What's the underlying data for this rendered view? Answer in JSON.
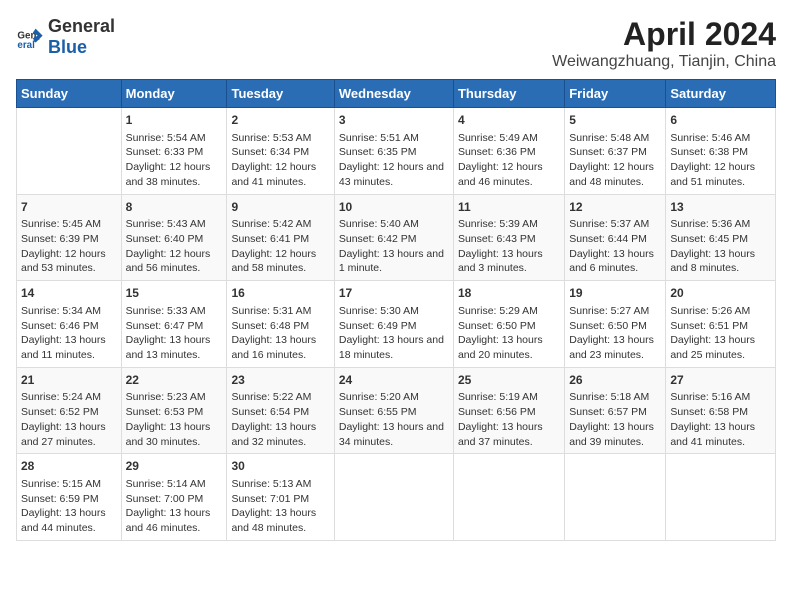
{
  "header": {
    "logo_general": "General",
    "logo_blue": "Blue",
    "title": "April 2024",
    "subtitle": "Weiwangzhuang, Tianjin, China"
  },
  "calendar": {
    "days_of_week": [
      "Sunday",
      "Monday",
      "Tuesday",
      "Wednesday",
      "Thursday",
      "Friday",
      "Saturday"
    ],
    "weeks": [
      [
        {
          "day": "",
          "sunrise": "",
          "sunset": "",
          "daylight": ""
        },
        {
          "day": "1",
          "sunrise": "Sunrise: 5:54 AM",
          "sunset": "Sunset: 6:33 PM",
          "daylight": "Daylight: 12 hours and 38 minutes."
        },
        {
          "day": "2",
          "sunrise": "Sunrise: 5:53 AM",
          "sunset": "Sunset: 6:34 PM",
          "daylight": "Daylight: 12 hours and 41 minutes."
        },
        {
          "day": "3",
          "sunrise": "Sunrise: 5:51 AM",
          "sunset": "Sunset: 6:35 PM",
          "daylight": "Daylight: 12 hours and 43 minutes."
        },
        {
          "day": "4",
          "sunrise": "Sunrise: 5:49 AM",
          "sunset": "Sunset: 6:36 PM",
          "daylight": "Daylight: 12 hours and 46 minutes."
        },
        {
          "day": "5",
          "sunrise": "Sunrise: 5:48 AM",
          "sunset": "Sunset: 6:37 PM",
          "daylight": "Daylight: 12 hours and 48 minutes."
        },
        {
          "day": "6",
          "sunrise": "Sunrise: 5:46 AM",
          "sunset": "Sunset: 6:38 PM",
          "daylight": "Daylight: 12 hours and 51 minutes."
        }
      ],
      [
        {
          "day": "7",
          "sunrise": "Sunrise: 5:45 AM",
          "sunset": "Sunset: 6:39 PM",
          "daylight": "Daylight: 12 hours and 53 minutes."
        },
        {
          "day": "8",
          "sunrise": "Sunrise: 5:43 AM",
          "sunset": "Sunset: 6:40 PM",
          "daylight": "Daylight: 12 hours and 56 minutes."
        },
        {
          "day": "9",
          "sunrise": "Sunrise: 5:42 AM",
          "sunset": "Sunset: 6:41 PM",
          "daylight": "Daylight: 12 hours and 58 minutes."
        },
        {
          "day": "10",
          "sunrise": "Sunrise: 5:40 AM",
          "sunset": "Sunset: 6:42 PM",
          "daylight": "Daylight: 13 hours and 1 minute."
        },
        {
          "day": "11",
          "sunrise": "Sunrise: 5:39 AM",
          "sunset": "Sunset: 6:43 PM",
          "daylight": "Daylight: 13 hours and 3 minutes."
        },
        {
          "day": "12",
          "sunrise": "Sunrise: 5:37 AM",
          "sunset": "Sunset: 6:44 PM",
          "daylight": "Daylight: 13 hours and 6 minutes."
        },
        {
          "day": "13",
          "sunrise": "Sunrise: 5:36 AM",
          "sunset": "Sunset: 6:45 PM",
          "daylight": "Daylight: 13 hours and 8 minutes."
        }
      ],
      [
        {
          "day": "14",
          "sunrise": "Sunrise: 5:34 AM",
          "sunset": "Sunset: 6:46 PM",
          "daylight": "Daylight: 13 hours and 11 minutes."
        },
        {
          "day": "15",
          "sunrise": "Sunrise: 5:33 AM",
          "sunset": "Sunset: 6:47 PM",
          "daylight": "Daylight: 13 hours and 13 minutes."
        },
        {
          "day": "16",
          "sunrise": "Sunrise: 5:31 AM",
          "sunset": "Sunset: 6:48 PM",
          "daylight": "Daylight: 13 hours and 16 minutes."
        },
        {
          "day": "17",
          "sunrise": "Sunrise: 5:30 AM",
          "sunset": "Sunset: 6:49 PM",
          "daylight": "Daylight: 13 hours and 18 minutes."
        },
        {
          "day": "18",
          "sunrise": "Sunrise: 5:29 AM",
          "sunset": "Sunset: 6:50 PM",
          "daylight": "Daylight: 13 hours and 20 minutes."
        },
        {
          "day": "19",
          "sunrise": "Sunrise: 5:27 AM",
          "sunset": "Sunset: 6:50 PM",
          "daylight": "Daylight: 13 hours and 23 minutes."
        },
        {
          "day": "20",
          "sunrise": "Sunrise: 5:26 AM",
          "sunset": "Sunset: 6:51 PM",
          "daylight": "Daylight: 13 hours and 25 minutes."
        }
      ],
      [
        {
          "day": "21",
          "sunrise": "Sunrise: 5:24 AM",
          "sunset": "Sunset: 6:52 PM",
          "daylight": "Daylight: 13 hours and 27 minutes."
        },
        {
          "day": "22",
          "sunrise": "Sunrise: 5:23 AM",
          "sunset": "Sunset: 6:53 PM",
          "daylight": "Daylight: 13 hours and 30 minutes."
        },
        {
          "day": "23",
          "sunrise": "Sunrise: 5:22 AM",
          "sunset": "Sunset: 6:54 PM",
          "daylight": "Daylight: 13 hours and 32 minutes."
        },
        {
          "day": "24",
          "sunrise": "Sunrise: 5:20 AM",
          "sunset": "Sunset: 6:55 PM",
          "daylight": "Daylight: 13 hours and 34 minutes."
        },
        {
          "day": "25",
          "sunrise": "Sunrise: 5:19 AM",
          "sunset": "Sunset: 6:56 PM",
          "daylight": "Daylight: 13 hours and 37 minutes."
        },
        {
          "day": "26",
          "sunrise": "Sunrise: 5:18 AM",
          "sunset": "Sunset: 6:57 PM",
          "daylight": "Daylight: 13 hours and 39 minutes."
        },
        {
          "day": "27",
          "sunrise": "Sunrise: 5:16 AM",
          "sunset": "Sunset: 6:58 PM",
          "daylight": "Daylight: 13 hours and 41 minutes."
        }
      ],
      [
        {
          "day": "28",
          "sunrise": "Sunrise: 5:15 AM",
          "sunset": "Sunset: 6:59 PM",
          "daylight": "Daylight: 13 hours and 44 minutes."
        },
        {
          "day": "29",
          "sunrise": "Sunrise: 5:14 AM",
          "sunset": "Sunset: 7:00 PM",
          "daylight": "Daylight: 13 hours and 46 minutes."
        },
        {
          "day": "30",
          "sunrise": "Sunrise: 5:13 AM",
          "sunset": "Sunset: 7:01 PM",
          "daylight": "Daylight: 13 hours and 48 minutes."
        },
        {
          "day": "",
          "sunrise": "",
          "sunset": "",
          "daylight": ""
        },
        {
          "day": "",
          "sunrise": "",
          "sunset": "",
          "daylight": ""
        },
        {
          "day": "",
          "sunrise": "",
          "sunset": "",
          "daylight": ""
        },
        {
          "day": "",
          "sunrise": "",
          "sunset": "",
          "daylight": ""
        }
      ]
    ]
  }
}
